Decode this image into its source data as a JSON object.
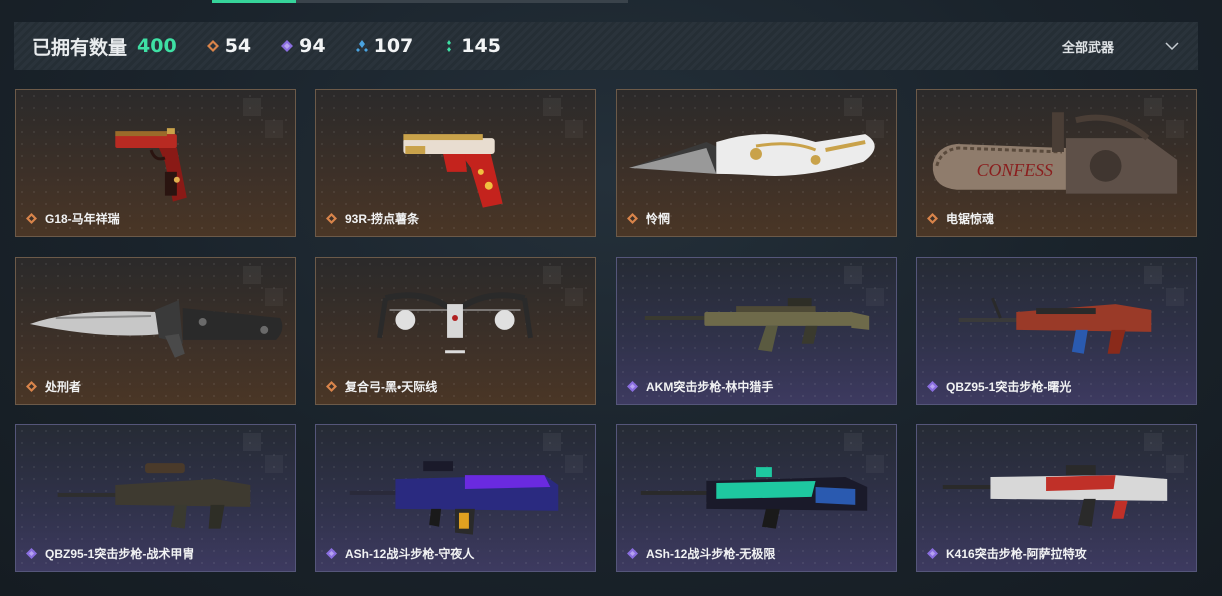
{
  "header": {
    "owned_label": "已拥有数量",
    "owned_value": "400",
    "stats": [
      {
        "icon": "orange-diamond-icon",
        "color": "#d9844a",
        "value": "54"
      },
      {
        "icon": "purple-diamond-icon",
        "color": "#8a6ee0",
        "value": "94"
      },
      {
        "icon": "blue-diamond-icon",
        "color": "#4aa3e0",
        "value": "107"
      },
      {
        "icon": "green-dots-icon",
        "color": "#3ee0a4",
        "value": "145"
      }
    ],
    "filter_label": "全部武器"
  },
  "colors": {
    "accent": "#3ee0a4",
    "orange_rarity": "#d9844a",
    "purple_rarity": "#8a6ee0"
  },
  "weapons": [
    {
      "name": "G18-马年祥瑞",
      "rarity": "orange",
      "icon": "pistol-icon"
    },
    {
      "name": "93R-捞点薯条",
      "rarity": "orange",
      "icon": "pistol-icon"
    },
    {
      "name": "怜惘",
      "rarity": "orange",
      "icon": "knife-icon"
    },
    {
      "name": "电锯惊魂",
      "rarity": "orange",
      "icon": "chainsaw-icon"
    },
    {
      "name": "处刑者",
      "rarity": "orange",
      "icon": "knife-icon"
    },
    {
      "name": "复合弓-黑•天际线",
      "rarity": "orange",
      "icon": "bow-icon"
    },
    {
      "name": "AKM突击步枪-林中猎手",
      "rarity": "purple",
      "icon": "rifle-icon"
    },
    {
      "name": "QBZ95-1突击步枪-曙光",
      "rarity": "purple",
      "icon": "rifle-icon"
    },
    {
      "name": "QBZ95-1突击步枪-战术甲胄",
      "rarity": "purple",
      "icon": "rifle-icon"
    },
    {
      "name": "ASh-12战斗步枪-守夜人",
      "rarity": "purple",
      "icon": "rifle-icon"
    },
    {
      "name": "ASh-12战斗步枪-无极限",
      "rarity": "purple",
      "icon": "rifle-icon"
    },
    {
      "name": "K416突击步枪-阿萨拉特攻",
      "rarity": "purple",
      "icon": "rifle-icon"
    }
  ]
}
